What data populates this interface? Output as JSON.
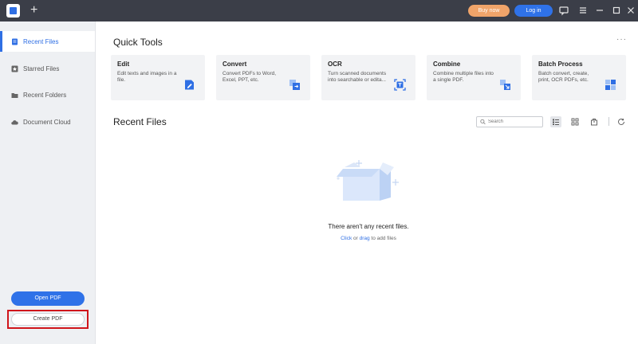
{
  "titlebar": {
    "new_tab_label": "+",
    "buy_label": "Buy now",
    "login_label": "Log in",
    "icons": [
      "chat-icon",
      "menu-icon",
      "minimize-icon",
      "maximize-icon",
      "close-icon"
    ]
  },
  "sidebar": {
    "items": [
      {
        "label": "Recent Files",
        "icon": "document-icon",
        "active": true
      },
      {
        "label": "Starred Files",
        "icon": "star-icon",
        "active": false
      },
      {
        "label": "Recent Folders",
        "icon": "folder-icon",
        "active": false
      },
      {
        "label": "Document Cloud",
        "icon": "cloud-icon",
        "active": false
      }
    ],
    "open_pdf_label": "Open PDF",
    "create_pdf_label": "Create PDF"
  },
  "quick_tools": {
    "title": "Quick Tools",
    "more_label": "···",
    "cards": [
      {
        "title": "Edit",
        "desc": "Edit texts and images in a file.",
        "icon": "edit-icon"
      },
      {
        "title": "Convert",
        "desc": "Convert PDFs to Word, Excel, PPT, etc.",
        "icon": "convert-icon"
      },
      {
        "title": "OCR",
        "desc": "Turn scanned documents into searchable or edita...",
        "icon": "ocr-icon"
      },
      {
        "title": "Combine",
        "desc": "Combine multiple files into a single PDF.",
        "icon": "combine-icon"
      },
      {
        "title": "Batch Process",
        "desc": "Batch convert, create, print, OCR PDFs, etc.",
        "icon": "batch-icon"
      }
    ]
  },
  "recent": {
    "title": "Recent Files",
    "search_placeholder": "Search",
    "empty_text": "There aren't any recent files.",
    "hint_click": "Click",
    "hint_or": " or ",
    "hint_drag": "drag",
    "hint_rest": " to add files"
  },
  "colors": {
    "accent": "#2f6fe4",
    "titlebar": "#3b3e48",
    "buy": "#f0a46a",
    "highlight_outline": "#d0151b"
  }
}
